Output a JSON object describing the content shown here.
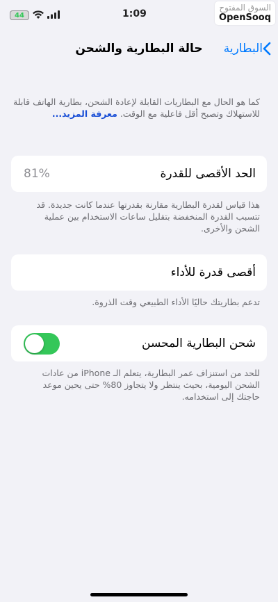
{
  "status_bar": {
    "battery_level": "44",
    "time": "1:09"
  },
  "watermark": {
    "arabic": "السوق المفتوح",
    "english": "OpenSooq"
  },
  "nav": {
    "back_label": "البطارية",
    "title": "حالة البطارية والشحن"
  },
  "intro": {
    "text": "كما هو الحال مع البطاريات القابلة لإعادة الشحن، بطارية الهاتف قابلة للاستهلاك وتصبح أقل فاعلية مع الوقت.",
    "learn_more": "معرفة المزيد..."
  },
  "maximum_capacity": {
    "label": "الحد الأقصى للقدرة",
    "value": "81%",
    "footnote": "هذا قياس لقدرة البطارية مقارنة بقدرتها عندما كانت جديدة. قد تتسبب القدرة المنخفضة بتقليل ساعات الاستخدام بين عملية الشحن والأخرى."
  },
  "peak_performance": {
    "label": "أقصى قدرة للأداء",
    "footnote": "تدعم بطاريتك حاليًا الأداء الطبيعي وقت الذروة."
  },
  "optimized_charging": {
    "label": "شحن البطارية المحسن",
    "enabled": true,
    "footnote": "للحد من استنزاف عمر البطارية، يتعلم الـ iPhone من عادات الشحن اليومية، بحيث ينتظر ولا يتجاوز 80% حتى يحين موعد حاجتك إلى استخدامه."
  },
  "colors": {
    "accent": "#007aff",
    "toggle_on": "#34c759",
    "background": "#f2f2f7"
  },
  "icons": {
    "back": "chevron-left-icon",
    "wifi": "wifi-icon",
    "signal": "cellular-signal-icon"
  }
}
